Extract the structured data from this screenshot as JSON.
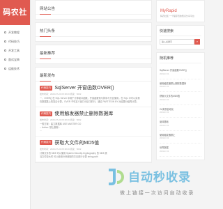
{
  "sidebar": {
    "logo": "码农社区",
    "items": [
      {
        "label": "开发教程",
        "icon": "folder-icon"
      },
      {
        "label": "代码技巧",
        "icon": "code-icon"
      },
      {
        "label": "开发工具",
        "icon": "tool-icon"
      },
      {
        "label": "面试宝典",
        "icon": "book-icon"
      },
      {
        "label": "运维技术",
        "icon": "server-icon"
      }
    ]
  },
  "main": {
    "notice_title": "网站公告",
    "hot_title": "热门头条",
    "newest_title": "最新推荐",
    "latest_title": "最新发布",
    "articles": [
      {
        "badge": "代码技巧",
        "title": "SqlServer 开窗函数OVER()",
        "meta": "发布时间：2023-07-24 05:18:46  阅读：5002",
        "excerpt": [
          "一、OVER() 在 SQL Server 中用于计算窗口函数。开窗函数常与排序与分区使用，在 SQL 中可以实现",
          "在数据集上的复杂计算。OVER 子句定义窗口分区中的行，通过 PARTITION BY 对结果分组再计算。"
        ]
      },
      {
        "badge": "代码技巧",
        "title": "使用触发器禁止删除数据库",
        "meta": "发布时间：2023-07-24 05:18:46  阅读：5002",
        "excerpt": [
          "一般方案：建立数据库 USE MASTER GO",
          "-- Author: 禁止删除--",
          "..."
        ]
      },
      {
        "badge": "代码技巧",
        "title": "获取大文件的MD5值",
        "meta": "发布时间：2023-07-24 05:18:46  阅读：5002",
        "excerpt": [
          "计算文件的 MD5 可以使用 System.Security.Cryptography 的 MD5 类",
          "当文件较大时 可以使用分块读取的方法进行计算 string path"
        ]
      }
    ]
  },
  "right": {
    "site_name": "MyRapid",
    "site_sub": "码农社区 一个程序员的知识分享平台",
    "search_title": "快速搜索",
    "search_placeholder": "输入关键字",
    "search_button_icon": "search-icon",
    "recommend_title": "随机推荐",
    "recommend": [
      {
        "title": "SqlServer 开窗函数OVER()",
        "date": "2023-07-24"
      },
      {
        "title": "使用触发器禁止删除数据库",
        "date": "2023-07-24"
      },
      {
        "title": "获取大文件的MD5值",
        "date": "2023-07-24"
      },
      {
        "title": "C#实现自动化",
        "date": "2023-07-24"
      },
      {
        "title": "窗体基础",
        "date": "2023-07-24"
      },
      {
        "title": "使用触发器禁止",
        "date": "2023-07-24"
      },
      {
        "title": "世界数据",
        "date": "2023-07-24"
      }
    ]
  },
  "watermark": {
    "title": "自动秒收录",
    "subtitle": "做 上 链 接   一 次 访 问   自 动 收 录"
  },
  "colors": {
    "accent": "#e05a50",
    "watermark_blue": "#1496d2"
  }
}
